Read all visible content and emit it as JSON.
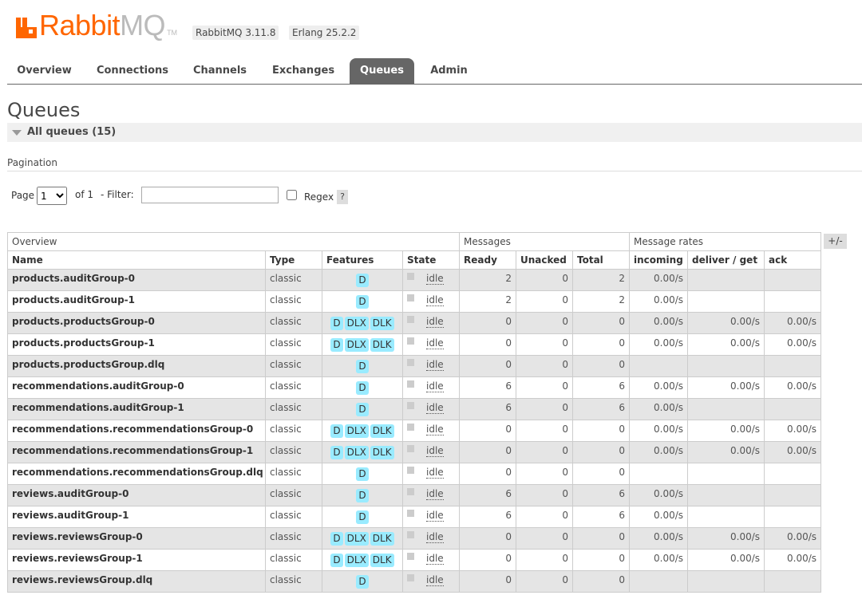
{
  "header": {
    "logo_rabbit": "Rabbit",
    "logo_mq": "MQ",
    "logo_tm": "TM",
    "version_rabbitmq": "RabbitMQ 3.11.8",
    "version_erlang": "Erlang 25.2.2"
  },
  "tabs": [
    "Overview",
    "Connections",
    "Channels",
    "Exchanges",
    "Queues",
    "Admin"
  ],
  "active_tab": "Queues",
  "page_title": "Queues",
  "section_title": "All queues (15)",
  "pagination": {
    "label": "Pagination",
    "page_label": "Page",
    "page_value": "1",
    "of_label": "of 1",
    "filter_label": "- Filter:",
    "filter_value": "",
    "regex_label": "Regex",
    "regex_help": "?"
  },
  "columns_toggle": "+/-",
  "table": {
    "groups": [
      "Overview",
      "Messages",
      "Message rates"
    ],
    "headers": [
      "Name",
      "Type",
      "Features",
      "State",
      "Ready",
      "Unacked",
      "Total",
      "incoming",
      "deliver / get",
      "ack"
    ],
    "rows": [
      {
        "name": "products.auditGroup-0",
        "type": "classic",
        "features": [
          "D"
        ],
        "state": "idle",
        "ready": "2",
        "unacked": "0",
        "total": "2",
        "incoming": "0.00/s",
        "deliver": "",
        "ack": ""
      },
      {
        "name": "products.auditGroup-1",
        "type": "classic",
        "features": [
          "D"
        ],
        "state": "idle",
        "ready": "2",
        "unacked": "0",
        "total": "2",
        "incoming": "0.00/s",
        "deliver": "",
        "ack": ""
      },
      {
        "name": "products.productsGroup-0",
        "type": "classic",
        "features": [
          "D",
          "DLX",
          "DLK"
        ],
        "state": "idle",
        "ready": "0",
        "unacked": "0",
        "total": "0",
        "incoming": "0.00/s",
        "deliver": "0.00/s",
        "ack": "0.00/s"
      },
      {
        "name": "products.productsGroup-1",
        "type": "classic",
        "features": [
          "D",
          "DLX",
          "DLK"
        ],
        "state": "idle",
        "ready": "0",
        "unacked": "0",
        "total": "0",
        "incoming": "0.00/s",
        "deliver": "0.00/s",
        "ack": "0.00/s"
      },
      {
        "name": "products.productsGroup.dlq",
        "type": "classic",
        "features": [
          "D"
        ],
        "state": "idle",
        "ready": "0",
        "unacked": "0",
        "total": "0",
        "incoming": "",
        "deliver": "",
        "ack": ""
      },
      {
        "name": "recommendations.auditGroup-0",
        "type": "classic",
        "features": [
          "D"
        ],
        "state": "idle",
        "ready": "6",
        "unacked": "0",
        "total": "6",
        "incoming": "0.00/s",
        "deliver": "0.00/s",
        "ack": "0.00/s"
      },
      {
        "name": "recommendations.auditGroup-1",
        "type": "classic",
        "features": [
          "D"
        ],
        "state": "idle",
        "ready": "6",
        "unacked": "0",
        "total": "6",
        "incoming": "0.00/s",
        "deliver": "",
        "ack": ""
      },
      {
        "name": "recommendations.recommendationsGroup-0",
        "type": "classic",
        "features": [
          "D",
          "DLX",
          "DLK"
        ],
        "state": "idle",
        "ready": "0",
        "unacked": "0",
        "total": "0",
        "incoming": "0.00/s",
        "deliver": "0.00/s",
        "ack": "0.00/s"
      },
      {
        "name": "recommendations.recommendationsGroup-1",
        "type": "classic",
        "features": [
          "D",
          "DLX",
          "DLK"
        ],
        "state": "idle",
        "ready": "0",
        "unacked": "0",
        "total": "0",
        "incoming": "0.00/s",
        "deliver": "0.00/s",
        "ack": "0.00/s"
      },
      {
        "name": "recommendations.recommendationsGroup.dlq",
        "type": "classic",
        "features": [
          "D"
        ],
        "state": "idle",
        "ready": "0",
        "unacked": "0",
        "total": "0",
        "incoming": "",
        "deliver": "",
        "ack": ""
      },
      {
        "name": "reviews.auditGroup-0",
        "type": "classic",
        "features": [
          "D"
        ],
        "state": "idle",
        "ready": "6",
        "unacked": "0",
        "total": "6",
        "incoming": "0.00/s",
        "deliver": "",
        "ack": ""
      },
      {
        "name": "reviews.auditGroup-1",
        "type": "classic",
        "features": [
          "D"
        ],
        "state": "idle",
        "ready": "6",
        "unacked": "0",
        "total": "6",
        "incoming": "0.00/s",
        "deliver": "",
        "ack": ""
      },
      {
        "name": "reviews.reviewsGroup-0",
        "type": "classic",
        "features": [
          "D",
          "DLX",
          "DLK"
        ],
        "state": "idle",
        "ready": "0",
        "unacked": "0",
        "total": "0",
        "incoming": "0.00/s",
        "deliver": "0.00/s",
        "ack": "0.00/s"
      },
      {
        "name": "reviews.reviewsGroup-1",
        "type": "classic",
        "features": [
          "D",
          "DLX",
          "DLK"
        ],
        "state": "idle",
        "ready": "0",
        "unacked": "0",
        "total": "0",
        "incoming": "0.00/s",
        "deliver": "0.00/s",
        "ack": "0.00/s"
      },
      {
        "name": "reviews.reviewsGroup.dlq",
        "type": "classic",
        "features": [
          "D"
        ],
        "state": "idle",
        "ready": "0",
        "unacked": "0",
        "total": "0",
        "incoming": "",
        "deliver": "",
        "ack": ""
      }
    ]
  },
  "colors": {
    "brand": "#ff6600",
    "badge": "#99ebff",
    "active_tab": "#666666"
  }
}
